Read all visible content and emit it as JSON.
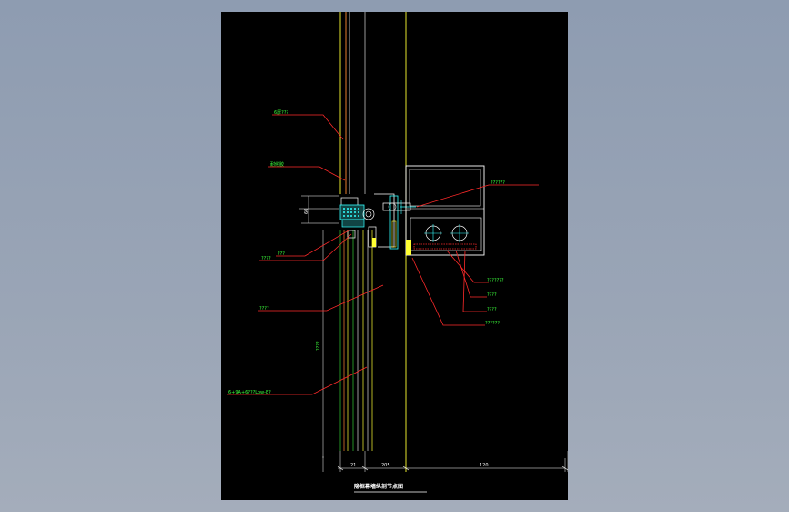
{
  "drawing": {
    "title": "隐框幕墙纵剖节点图",
    "colors": {
      "canvas": "#000000",
      "leader": "#ff2a2a",
      "label": "#3cff3c",
      "yellow": "#ffff33",
      "white": "#ffffff",
      "cyan": "#33ffff",
      "green": "#33cc33"
    },
    "labels": {
      "upper_glass": "6厚???",
      "sealant": "耐候胶",
      "pressure_plate": "铝合金压板",
      "left_a": "???",
      "left_b": "????",
      "left_c": "????",
      "lower_glass": "6+9A+6???Low-E?",
      "vertical_note": "????",
      "right_a": "??????",
      "right_b": "???????",
      "right_c": "????",
      "right_d": "????",
      "right_e": "??????"
    },
    "dimensions": {
      "d1": "21",
      "d2": "205",
      "d3": "120",
      "left_small": "60"
    }
  }
}
